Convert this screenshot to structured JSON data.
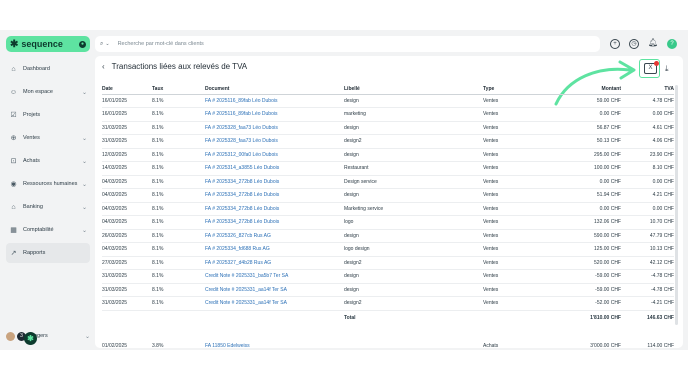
{
  "app": {
    "brand": "sequence",
    "brand_mark": "✱"
  },
  "sidebar": {
    "items": [
      {
        "label": "Dashboard",
        "icon": "home-icon",
        "glyph": "⌂",
        "chev": ""
      },
      {
        "label": "Mon espace",
        "icon": "person-icon",
        "glyph": "☺",
        "chev": "⌄"
      },
      {
        "label": "Projets",
        "icon": "check-square-icon",
        "glyph": "☑",
        "chev": ""
      },
      {
        "label": "Ventes",
        "icon": "lock-icon",
        "glyph": "⊕",
        "chev": "⌄"
      },
      {
        "label": "Achats",
        "icon": "bag-icon",
        "glyph": "⊡",
        "chev": "⌄"
      },
      {
        "label": "Ressources humaines",
        "icon": "people-icon",
        "glyph": "◉",
        "chev": "⌄"
      },
      {
        "label": "Banking",
        "icon": "bank-icon",
        "glyph": "⌂",
        "chev": "⌄"
      },
      {
        "label": "Comptabilité",
        "icon": "calculator-icon",
        "glyph": "▦",
        "chev": "⌄"
      },
      {
        "label": "Rapports",
        "icon": "chart-icon",
        "glyph": "↗",
        "chev": ""
      }
    ],
    "user": {
      "name": "Rogers",
      "badge": "3"
    }
  },
  "search": {
    "placeholder": "Recherche par mot-clé dans clients"
  },
  "page": {
    "title": "Transactions liées aux relevés de TVA"
  },
  "table": {
    "headers": {
      "date": "Date",
      "taux": "Taux",
      "document": "Document",
      "libelle": "Libellé",
      "type": "Type",
      "montant": "Montant",
      "tva": "TVA"
    },
    "rows": [
      {
        "date": "16/01/2025",
        "taux": "8.1%",
        "document": "FA # 2025116_89fab Léo Dubois",
        "libelle": "design",
        "type": "Ventes",
        "montant": "59.00 CHF",
        "tva": "4.78 CHF"
      },
      {
        "date": "16/01/2025",
        "taux": "8.1%",
        "document": "FA # 2025116_89fab Léo Dubois",
        "libelle": "marketing",
        "type": "Ventes",
        "montant": "0.00 CHF",
        "tva": "0.00 CHF"
      },
      {
        "date": "31/03/2025",
        "taux": "8.1%",
        "document": "FA # 2025328_faa73 Léo Dubois",
        "libelle": "design",
        "type": "Ventes",
        "montant": "56.87 CHF",
        "tva": "4.61 CHF"
      },
      {
        "date": "31/03/2025",
        "taux": "8.1%",
        "document": "FA # 2025328_faa73 Léo Dubois",
        "libelle": "design2",
        "type": "Ventes",
        "montant": "50.13 CHF",
        "tva": "4.06 CHF"
      },
      {
        "date": "12/03/2025",
        "taux": "8.1%",
        "document": "FA # 2025312_00fa0 Léo Dubois",
        "libelle": "design",
        "type": "Ventes",
        "montant": "295.00 CHF",
        "tva": "23.90 CHF"
      },
      {
        "date": "14/03/2025",
        "taux": "8.1%",
        "document": "FA # 2025314_a3855 Léo Dubois",
        "libelle": "Restaurant",
        "type": "Ventes",
        "montant": "100.00 CHF",
        "tva": "8.10 CHF"
      },
      {
        "date": "04/03/2025",
        "taux": "8.1%",
        "document": "FA # 2025334_272b8 Léo Dubois",
        "libelle": "Design service",
        "type": "Ventes",
        "montant": "0.00 CHF",
        "tva": "0.00 CHF"
      },
      {
        "date": "04/03/2025",
        "taux": "8.1%",
        "document": "FA # 2025334_272b8 Léo Dubois",
        "libelle": "design",
        "type": "Ventes",
        "montant": "51.94 CHF",
        "tva": "4.21 CHF"
      },
      {
        "date": "04/03/2025",
        "taux": "8.1%",
        "document": "FA # 2025334_272b8 Léo Dubois",
        "libelle": "Marketing service",
        "type": "Ventes",
        "montant": "0.00 CHF",
        "tva": "0.00 CHF"
      },
      {
        "date": "04/03/2025",
        "taux": "8.1%",
        "document": "FA # 2025334_272b8 Léo Dubois",
        "libelle": "logo",
        "type": "Ventes",
        "montant": "132.06 CHF",
        "tva": "10.70 CHF"
      },
      {
        "date": "26/03/2025",
        "taux": "8.1%",
        "document": "FA # 2025326_827cb Rus AG",
        "libelle": "design",
        "type": "Ventes",
        "montant": "590.00 CHF",
        "tva": "47.79 CHF"
      },
      {
        "date": "04/03/2025",
        "taux": "8.1%",
        "document": "FA # 2025334_fd688 Rus AG",
        "libelle": "logo design",
        "type": "Ventes",
        "montant": "125.00 CHF",
        "tva": "10.13 CHF"
      },
      {
        "date": "27/03/2025",
        "taux": "8.1%",
        "document": "FA # 2025327_d4b28 Rus AG",
        "libelle": "design2",
        "type": "Ventes",
        "montant": "520.00 CHF",
        "tva": "42.12 CHF"
      },
      {
        "date": "31/03/2025",
        "taux": "8.1%",
        "document": "Credit Note # 2025331_ba5b7 Ter SA",
        "libelle": "design",
        "type": "Ventes",
        "montant": "-59.00 CHF",
        "tva": "-4.78 CHF"
      },
      {
        "date": "31/03/2025",
        "taux": "8.1%",
        "document": "Credit Note # 2025331_aa14f Ter SA",
        "libelle": "design",
        "type": "Ventes",
        "montant": "-59.00 CHF",
        "tva": "-4.78 CHF"
      },
      {
        "date": "31/03/2025",
        "taux": "8.1%",
        "document": "Credit Note # 2025331_aa14f Ter SA",
        "libelle": "design2",
        "type": "Ventes",
        "montant": "-52.00 CHF",
        "tva": "-4.21 CHF"
      }
    ],
    "total": {
      "label": "Total",
      "montant": "1'810.00 CHF",
      "tva": "146.63 CHF"
    },
    "extra_row": {
      "date": "01/02/2025",
      "taux": "3.8%",
      "document": "FA 11850 Edelweiss",
      "libelle": "",
      "type": "Achats",
      "montant": "3'000.00 CHF",
      "tva": "114.00 CHF"
    }
  },
  "colors": {
    "brand": "#5ee3a1",
    "link": "#2a6fb6",
    "alert": "#e53935"
  }
}
